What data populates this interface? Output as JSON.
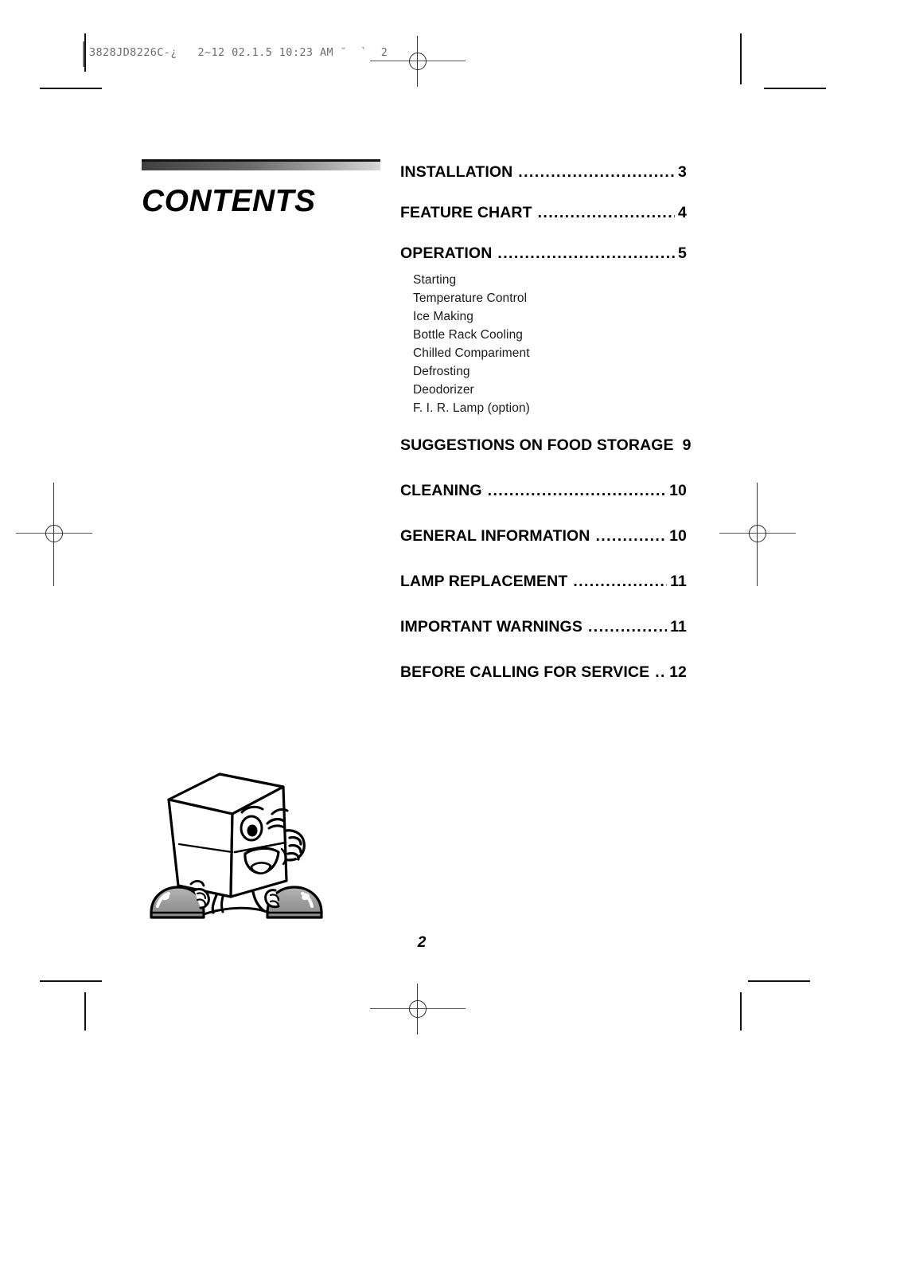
{
  "document": {
    "header_code": "3828JD8226C-¿   2~12 02.1.5 10:23 AM ˘  `  2",
    "page_number": "2"
  },
  "contents": {
    "title": "CONTENTS"
  },
  "toc": {
    "leader_dots": "............................................................",
    "entries": [
      {
        "label": "INSTALLATION",
        "page": "3"
      },
      {
        "label": "FEATURE CHART",
        "page": "4"
      },
      {
        "label": "OPERATION",
        "page": "5"
      },
      {
        "label": "SUGGESTIONS ON FOOD STORAGE",
        "page": "9"
      },
      {
        "label": "CLEANING",
        "page": "10"
      },
      {
        "label": "GENERAL INFORMATION",
        "page": "10"
      },
      {
        "label": "LAMP REPLACEMENT",
        "page": "11"
      },
      {
        "label": "IMPORTANT WARNINGS",
        "page": "11"
      },
      {
        "label": "BEFORE CALLING FOR SERVICE",
        "page": "12"
      }
    ],
    "operation_subitems": [
      "Starting",
      "Temperature Control",
      "Ice Making",
      "Bottle Rack Cooling",
      "Chilled Compariment",
      "Defrosting",
      "Deodorizer",
      "F. I. R. Lamp (option)"
    ]
  },
  "illustration": {
    "name": "refrigerator-mascot-character",
    "shoe_color": "#9a9a9a",
    "outline_color": "#000000"
  }
}
